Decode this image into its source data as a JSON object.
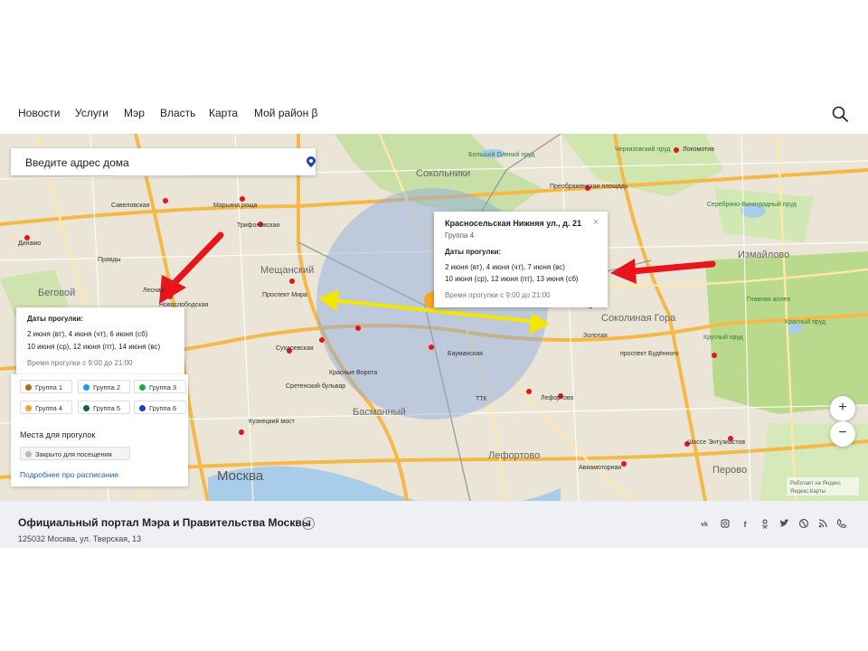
{
  "nav": {
    "items": [
      "Новости",
      "Услуги",
      "Мэр",
      "Власть",
      "Карта",
      "Мой район β"
    ]
  },
  "search": {
    "placeholder": "Введите адрес дома"
  },
  "map": {
    "labels": {
      "sokolniki": "Сокольники",
      "meshchansky": "Мещанский",
      "begovoy": "Беговой",
      "izmaylovo": "Измайлово",
      "sokolinaya_gora": "Соколиная Гора",
      "basmanny": "Басманный",
      "lefortovo": "Лефортово",
      "perovo": "Перово",
      "moskva": "Москва",
      "savelovskaya": "Савеловская",
      "maryina_roshcha": "Марьина роща",
      "trifonovskaya": "Трифоновская",
      "prospekt_mira": "Проспект Мира",
      "sukharevskaya": "Сухаревская",
      "krasnye_vorota": "Красные Ворота",
      "sretensky": "Сретенский бульвар",
      "kuznetsky": "Кузнецкий мост",
      "baumanskaya": "Бауманская",
      "lefortovo_st": "Лефортово",
      "aviamotornaya": "Авиамоторная",
      "shosse": "Шоссе Энтузиастов",
      "preobrazh": "Преображенская площадь",
      "lokomotiv": "Локомотив",
      "dinamo": "Динамо",
      "lesnaya": "Лесная",
      "novoslob": "Новослободская",
      "pravdy": "Правды",
      "buryakova": "проспект Будённого",
      "bolshoy_oleny": "Большой Олений пруд",
      "serebryano": "Серебряно-Виноградный пруд",
      "krasny_prud": "Красный пруд",
      "kruglyi": "Круглый пруд",
      "glavnaya": "Главная аллея",
      "zolotaya": "Золотая",
      "tkk": "ТТК",
      "cherkizovsky": "Черкизовский пруд",
      "yandex": "Работает на Яндекс",
      "yandex2": "Яндекс.Карты"
    }
  },
  "popup_right": {
    "title": "Красносельская Нижняя ул., д. 21",
    "group": "Группа 4",
    "dates_label": "Даты прогулки:",
    "dates_line1": "2 июня (вт), 4 июня (чт), 7 июня (вс)",
    "dates_line2": "10 июня (ср), 12 июня (пт), 13 июня (сб)",
    "time": "Время прогулки с 9:00 до 21:00",
    "close": "×"
  },
  "popup_left": {
    "dates_label": "Даты прогулки:",
    "dates_line1": "2 июня (вт), 4 июня (чт), 6 июня (сб)",
    "dates_line2": "10 июня (ср), 12 июня (пт), 14 июня (вс)",
    "time": "Время прогулки с 9:00 до 21:00"
  },
  "legend": {
    "groups": [
      {
        "label": "Группа 1",
        "color": "#b5651d"
      },
      {
        "label": "Группа 2",
        "color": "#2196f3"
      },
      {
        "label": "Группа 3",
        "color": "#2e9e4f"
      },
      {
        "label": "Группа 4",
        "color": "#f5a623"
      },
      {
        "label": "Группа 5",
        "color": "#0b6b3a"
      },
      {
        "label": "Группа 6",
        "color": "#1e3fbf"
      }
    ],
    "places_title": "Места для прогулок",
    "closed_label": "Закрыто для посещения",
    "more_link": "Подробнее про расписание"
  },
  "zoom": {
    "in": "+",
    "out": "−"
  },
  "footer": {
    "title": "Официальный портал Мэра и Правительства Москвы",
    "address": "125032 Москва, ул. Тверская, 13",
    "help": "?",
    "social": [
      "vk",
      "ig",
      "f",
      "ok",
      "tw",
      "lj",
      "rss",
      "ph"
    ]
  },
  "colors": {
    "accent_yellow": "#f5e600",
    "arrow_red": "#e8141c",
    "circle_blue": "#8aa8e0",
    "marker_orange": "#f5a623",
    "link": "#1a5fb4"
  }
}
